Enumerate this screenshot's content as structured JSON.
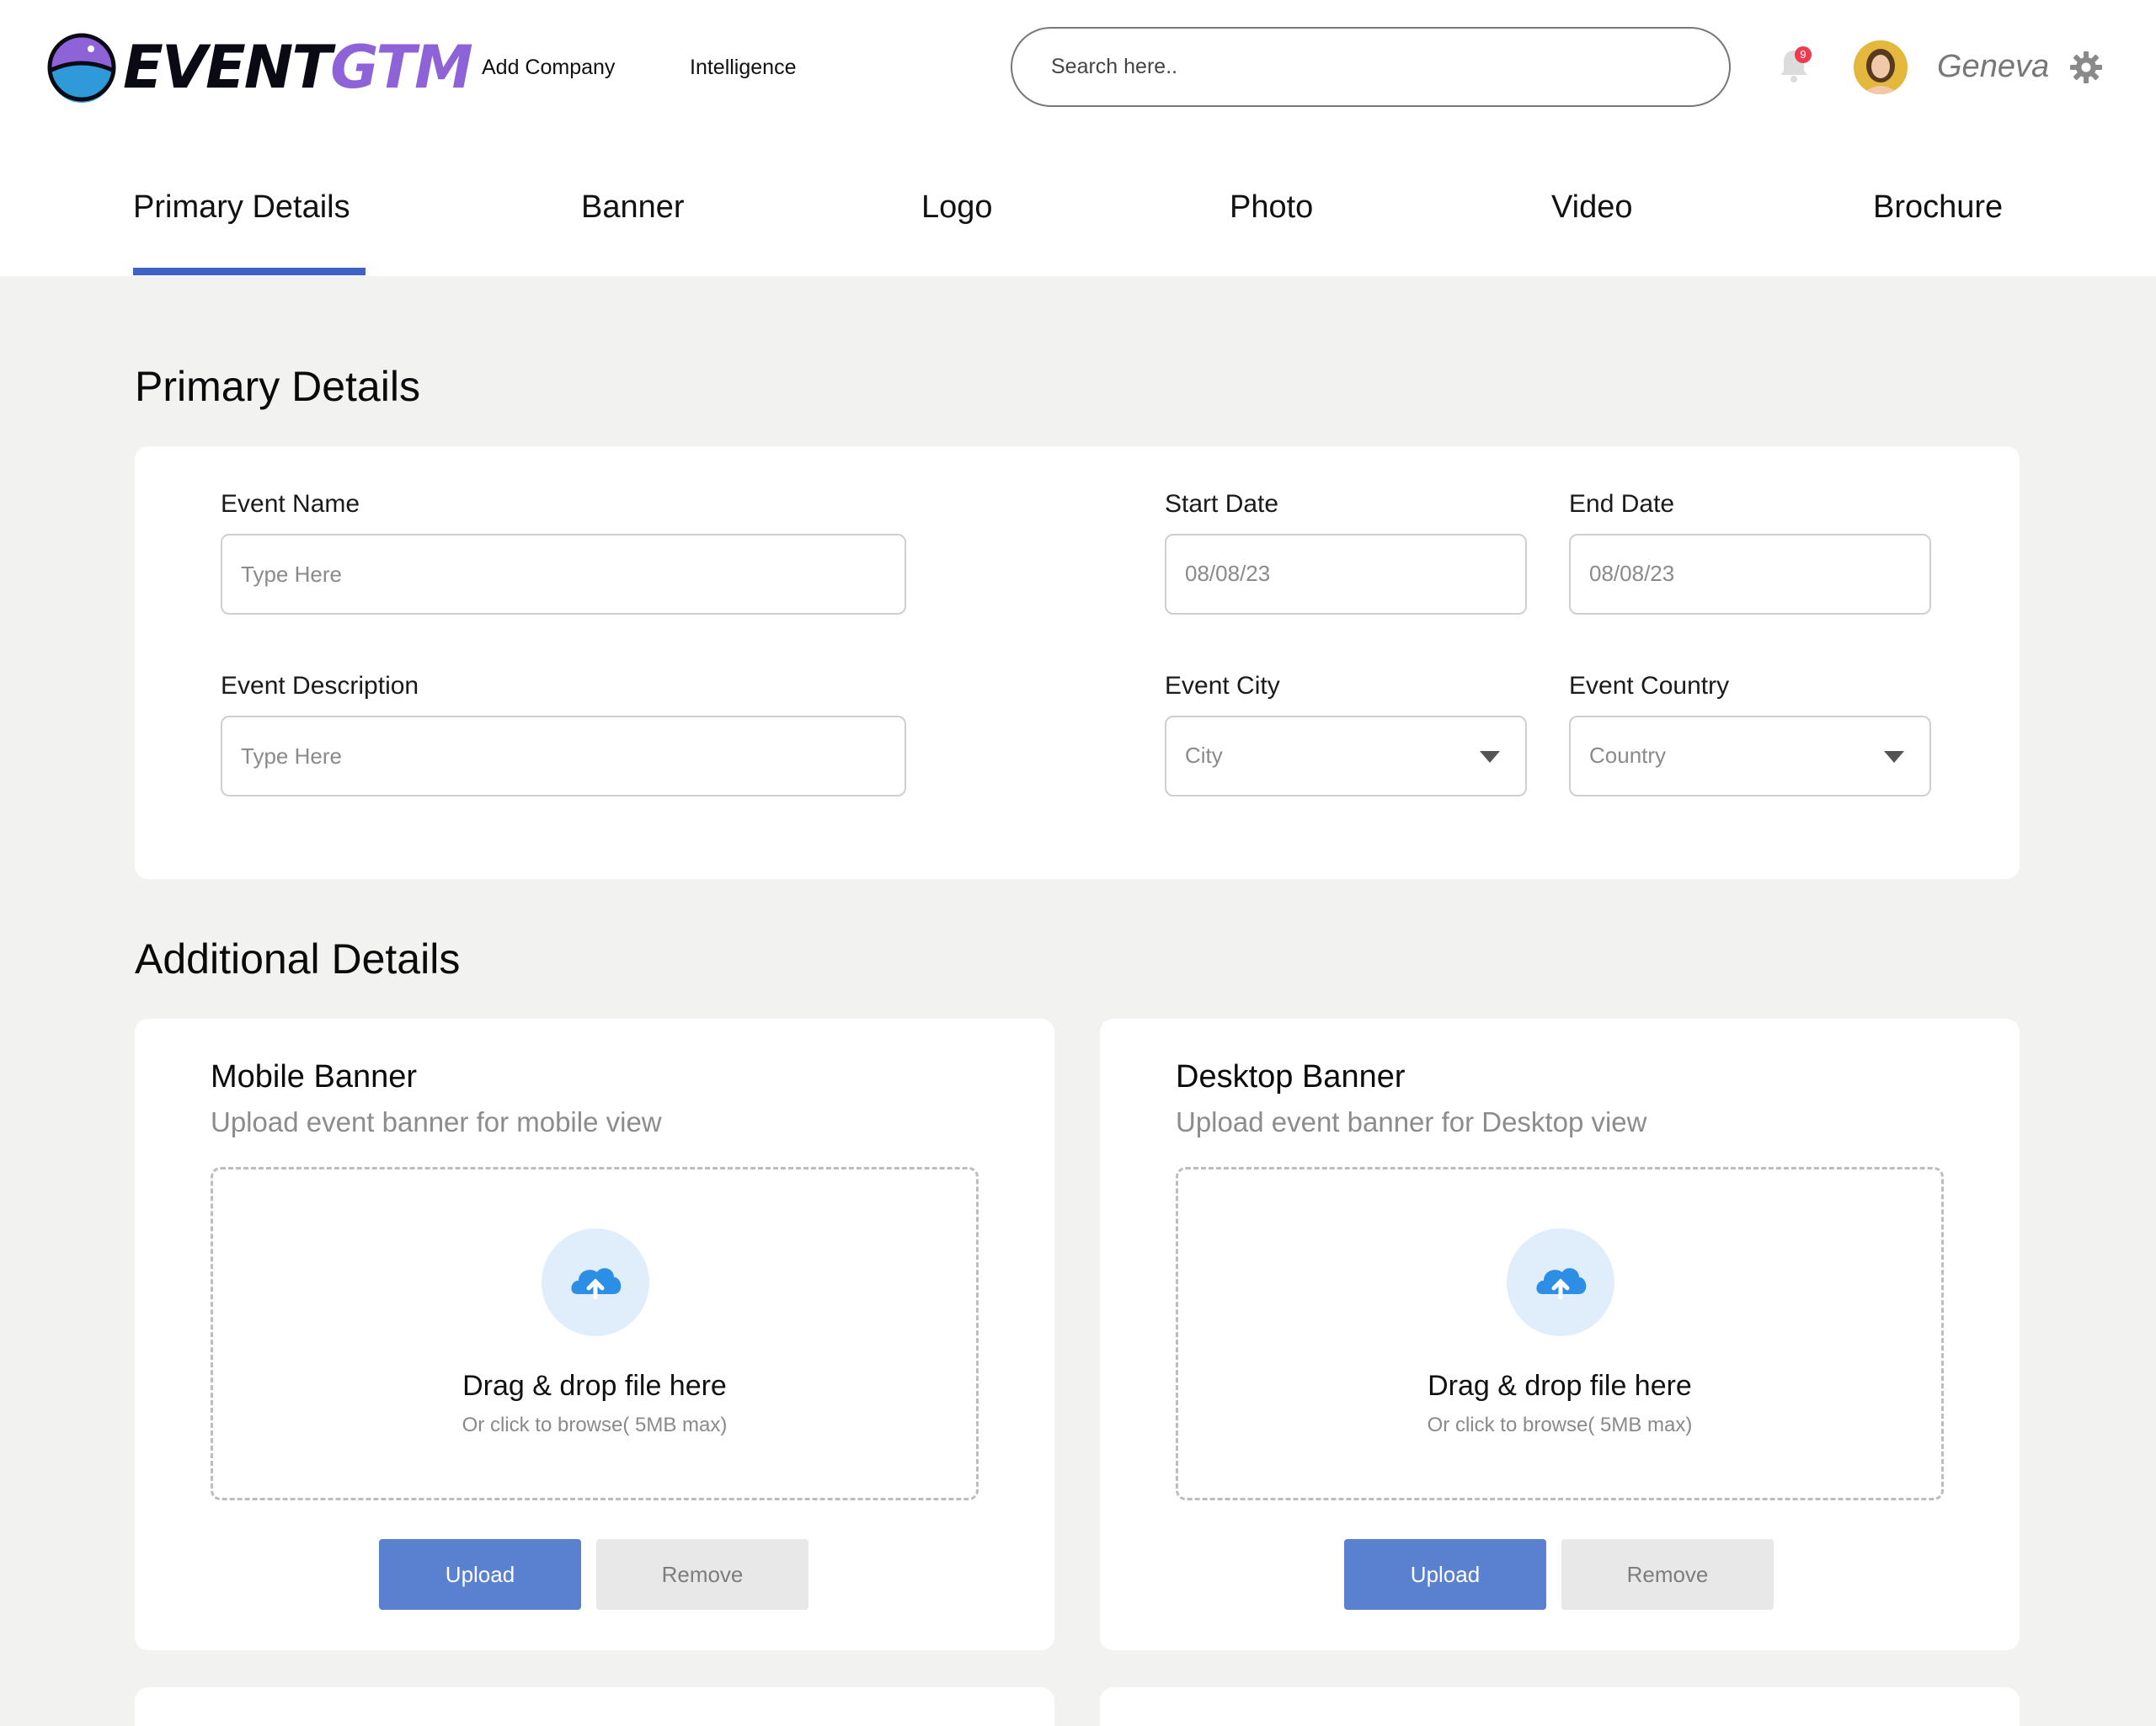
{
  "app": {
    "logo_text_dark": "EVENT",
    "logo_text_accent": "GTM",
    "accent_color": "#8f63d8",
    "primary_color": "#3e63c4"
  },
  "nav": {
    "links": [
      "Add Company",
      "Intelligence"
    ]
  },
  "search": {
    "placeholder": "Search here.."
  },
  "notifications": {
    "count": "9",
    "icon": "bell-icon"
  },
  "user": {
    "name": "Geneva",
    "avatar": "avatar-image",
    "settings_icon": "gear-icon"
  },
  "tabs": {
    "items": [
      "Primary Details",
      "Banner",
      "Logo",
      "Photo",
      "Video",
      "Brochure"
    ],
    "active": "Primary Details"
  },
  "primary": {
    "title": "Primary Details",
    "event_name": {
      "label": "Event Name",
      "placeholder": "Type Here"
    },
    "event_description": {
      "label": "Event Description",
      "placeholder": "Type Here"
    },
    "start_date": {
      "label": "Start Date",
      "value": "08/08/23"
    },
    "end_date": {
      "label": "End Date",
      "value": "08/08/23"
    },
    "event_city": {
      "label": "Event City",
      "value": "City"
    },
    "event_country": {
      "label": "Event Country",
      "value": "Country"
    }
  },
  "additional": {
    "title": "Additional Details",
    "mobile": {
      "title": "Mobile Banner",
      "subtitle": "Upload event banner for mobile view",
      "drop_title": "Drag & drop file here",
      "drop_sub": "Or click to browse( 5MB max)",
      "upload": "Upload",
      "remove": "Remove"
    },
    "desktop": {
      "title": "Desktop Banner",
      "subtitle": "Upload event banner for Desktop view",
      "drop_title": "Drag & drop file here",
      "drop_sub": "Or click to browse( 5MB max)",
      "upload": "Upload",
      "remove": "Remove"
    }
  }
}
